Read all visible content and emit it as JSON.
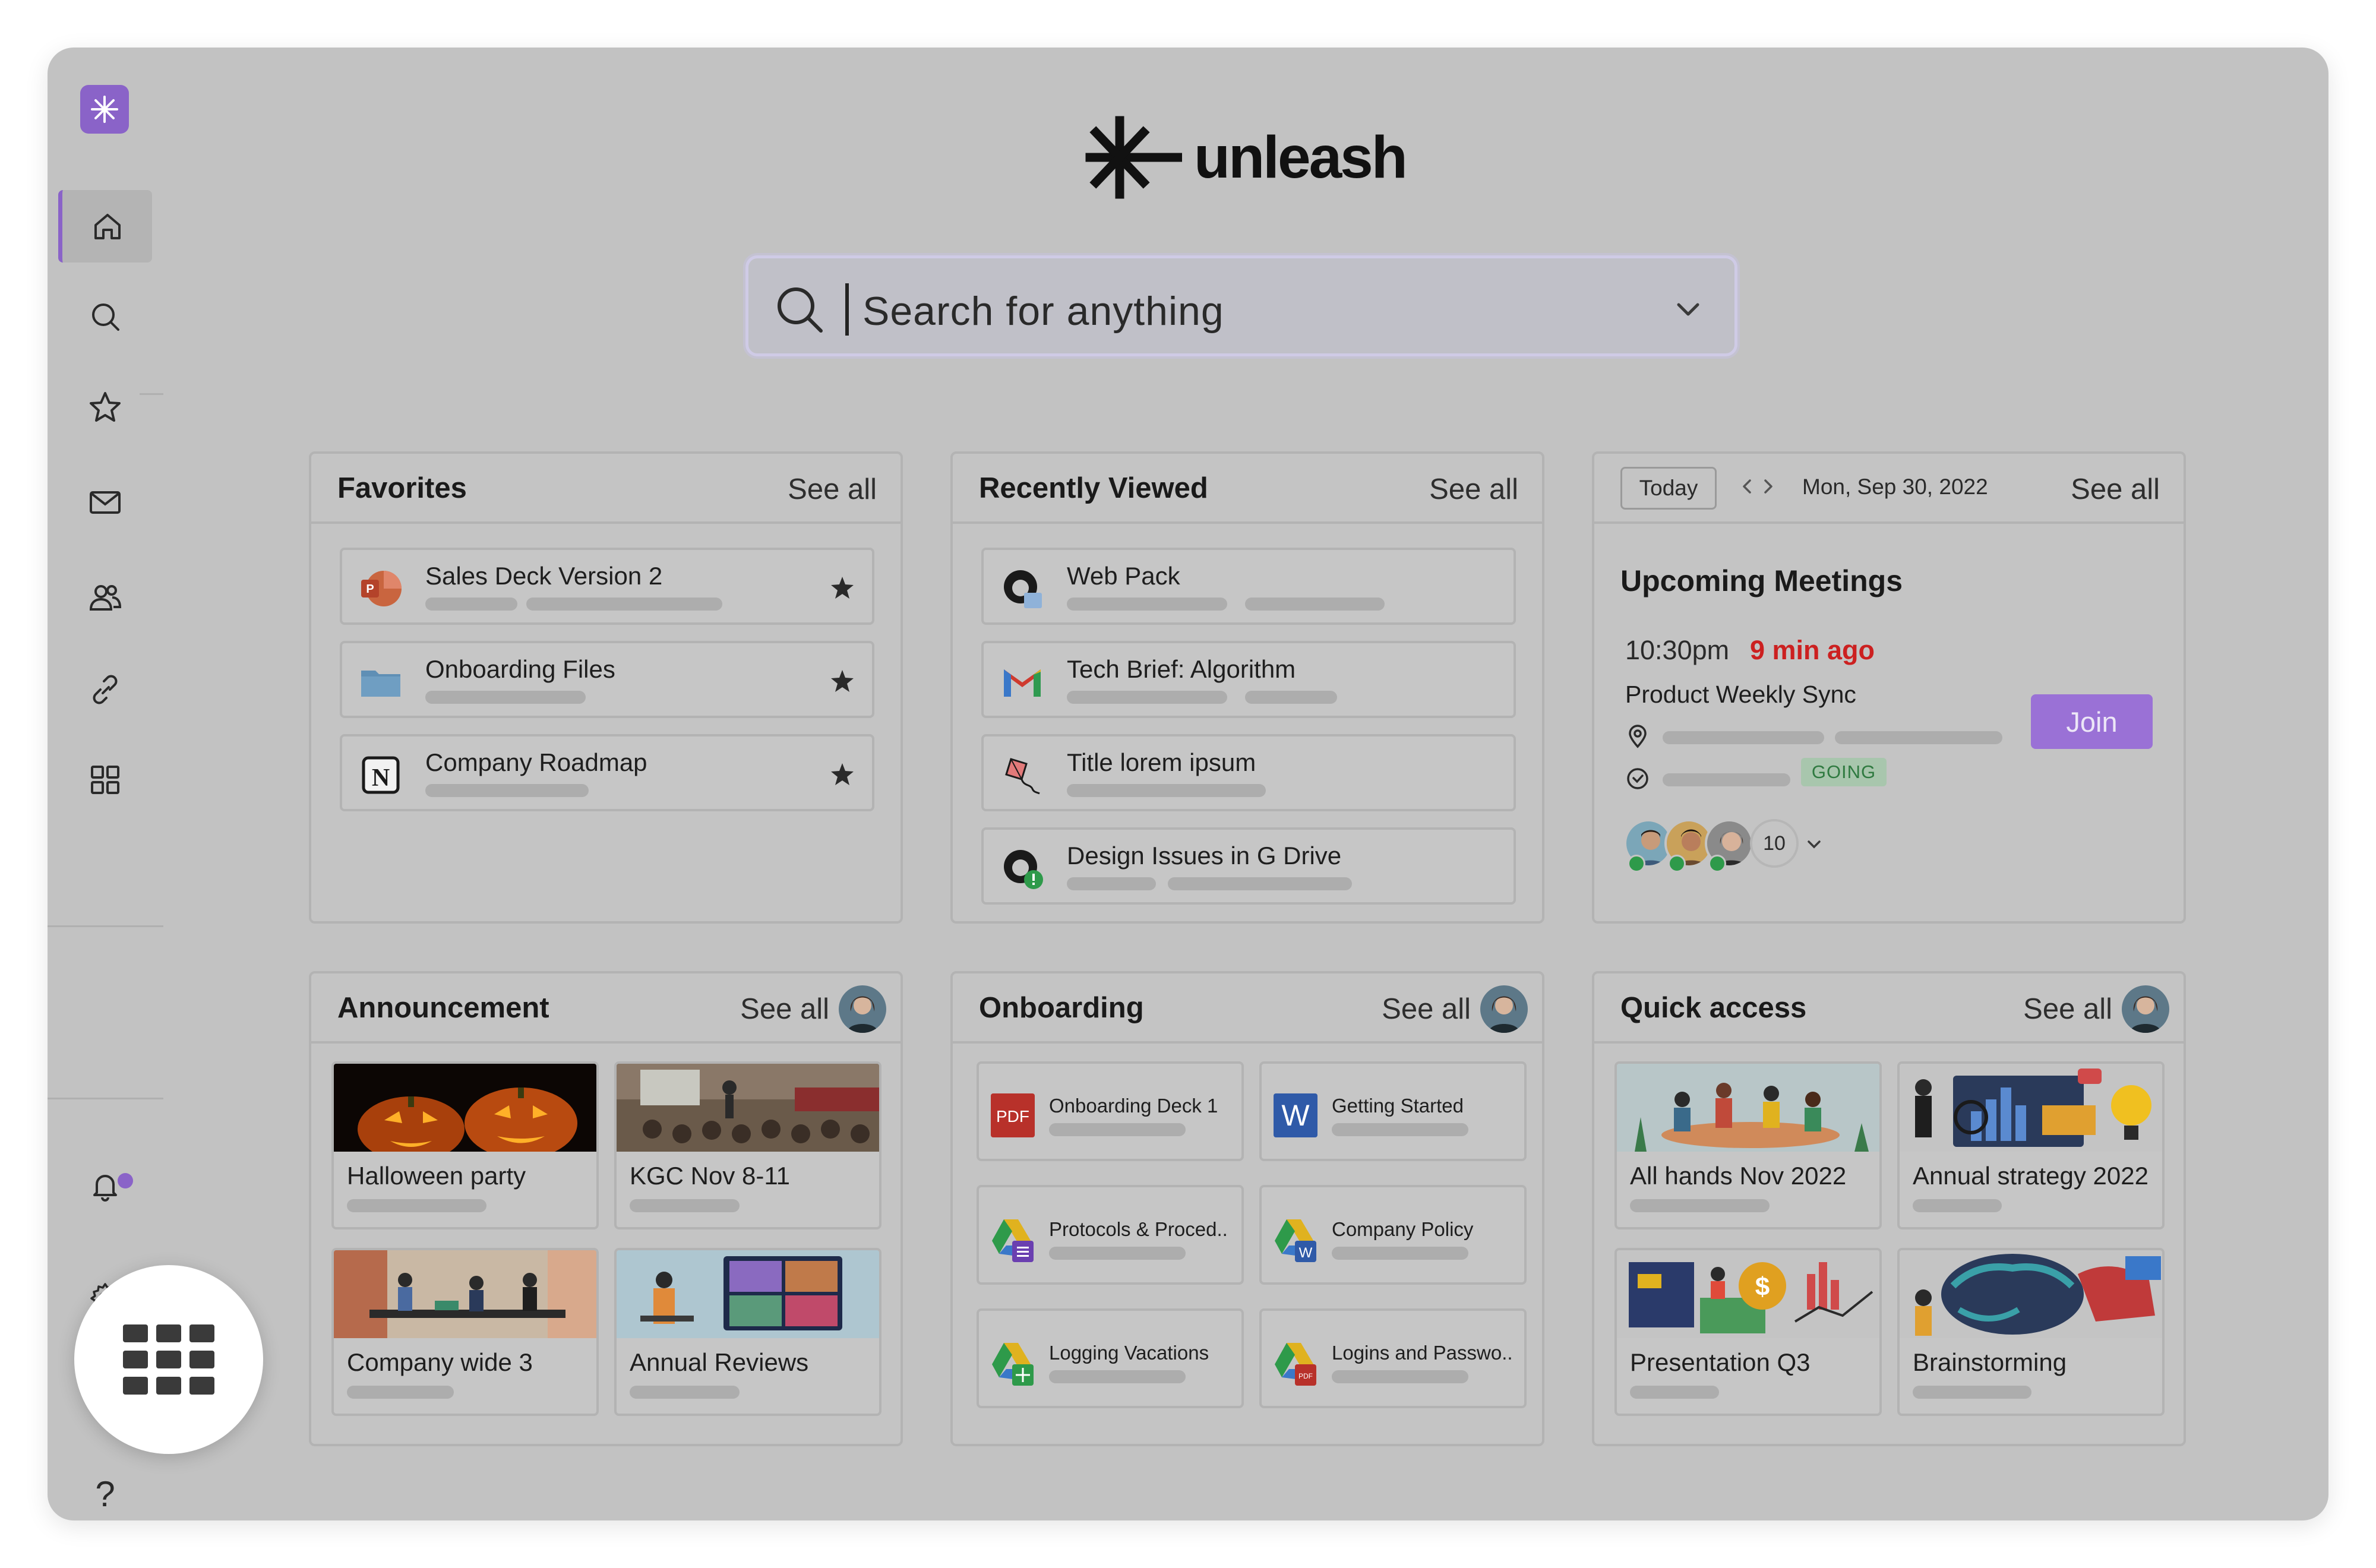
{
  "brand": {
    "name": "unleash",
    "accent": "#8a63c8"
  },
  "sidebar": {
    "items": [
      {
        "name": "home",
        "icon": "home-icon"
      },
      {
        "name": "search",
        "icon": "search-icon"
      },
      {
        "name": "favorites",
        "icon": "star-icon"
      },
      {
        "name": "mail",
        "icon": "mail-icon"
      },
      {
        "name": "people",
        "icon": "people-icon"
      },
      {
        "name": "links",
        "icon": "link-icon"
      },
      {
        "name": "apps",
        "icon": "grid-icon"
      }
    ],
    "bottom": [
      {
        "name": "notifications",
        "icon": "bell-icon"
      },
      {
        "name": "settings",
        "icon": "gear-icon"
      },
      {
        "name": "help",
        "icon": "help-icon",
        "glyph": "?"
      }
    ]
  },
  "search": {
    "placeholder": "Search for anything"
  },
  "common": {
    "see_all": "See all"
  },
  "favorites": {
    "title": "Favorites",
    "items": [
      {
        "label": "Sales Deck Version 2",
        "icon": "powerpoint-icon"
      },
      {
        "label": "Onboarding Files",
        "icon": "folder-icon"
      },
      {
        "label": "Company Roadmap",
        "icon": "notion-icon"
      }
    ]
  },
  "recent": {
    "title": "Recently Viewed",
    "items": [
      {
        "label": "Web Pack",
        "icon": "github-icon"
      },
      {
        "label": "Tech Brief: Algorithm",
        "icon": "gmail-icon"
      },
      {
        "label": "Title lorem ipsum",
        "icon": "kite-icon"
      },
      {
        "label": "Design Issues in G Drive",
        "icon": "github-icon"
      }
    ]
  },
  "meetings": {
    "today_label": "Today",
    "date": "Mon, Sep 30, 2022",
    "title": "Upcoming Meetings",
    "time": "10:30pm",
    "ago": "9 min ago",
    "name": "Product Weekly Sync",
    "join_label": "Join",
    "status": "GOING",
    "attendee_count": "10",
    "status_color": "#2f7a40",
    "alert_color": "#cc2020"
  },
  "announcement": {
    "title": "Announcement",
    "tiles": [
      {
        "label": "Halloween party"
      },
      {
        "label": "KGC Nov 8-11"
      },
      {
        "label": "Company wide 3"
      },
      {
        "label": "Annual Reviews"
      }
    ]
  },
  "onboarding": {
    "title": "Onboarding",
    "docs": [
      {
        "label": "Onboarding Deck 1",
        "icon": "pdf-icon"
      },
      {
        "label": "Getting Started",
        "icon": "word-icon"
      },
      {
        "label": "Protocols & Proced..",
        "icon": "gdrive-forms-icon"
      },
      {
        "label": "Company Policy",
        "icon": "gdrive-word-icon"
      },
      {
        "label": "Logging Vacations",
        "icon": "gdrive-sheets-icon"
      },
      {
        "label": "Logins and Passwo..",
        "icon": "gdrive-pdf-icon"
      }
    ],
    "pdf_badge": "PDF",
    "word_badge": "W"
  },
  "quick": {
    "title": "Quick access",
    "tiles": [
      {
        "label": "All hands Nov 2022"
      },
      {
        "label": "Annual strategy 2022"
      },
      {
        "label": "Presentation Q3"
      },
      {
        "label": "Brainstorming"
      }
    ]
  }
}
